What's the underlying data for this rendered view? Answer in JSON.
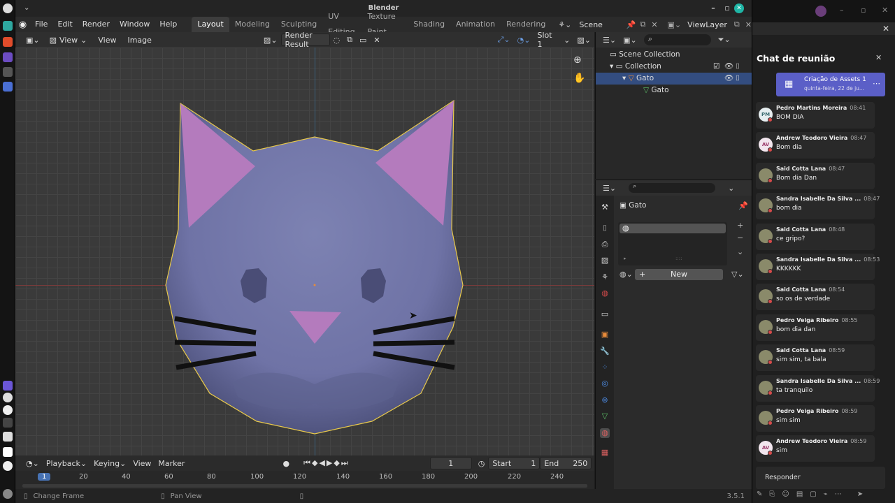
{
  "app": {
    "title": "Blender"
  },
  "menubar": {
    "menus": [
      "File",
      "Edit",
      "Render",
      "Window",
      "Help"
    ],
    "workspaces": [
      "Layout",
      "Modeling",
      "Sculpting",
      "UV Editing",
      "Texture Paint",
      "Shading",
      "Animation",
      "Rendering"
    ],
    "active_workspace": "Layout",
    "scene": "Scene",
    "view_layer": "ViewLayer"
  },
  "image_editor": {
    "view_menu": "View",
    "menus": [
      "View",
      "Image"
    ],
    "image_name": "Render Result",
    "slot": "Slot 1"
  },
  "outliner": {
    "scene_collection": "Scene Collection",
    "collection": "Collection",
    "object": "Gato",
    "mesh": "Gato"
  },
  "properties": {
    "object_name": "Gato",
    "new_button": "New"
  },
  "timeline": {
    "menus": [
      "Playback",
      "Keying",
      "View",
      "Marker"
    ],
    "current_frame": "1",
    "start_label": "Start",
    "start": "1",
    "end_label": "End",
    "end": "250",
    "ruler_marks": [
      "1",
      "20",
      "40",
      "60",
      "80",
      "100",
      "120",
      "140",
      "160",
      "180",
      "200",
      "220",
      "240"
    ]
  },
  "statusbar": {
    "left": "Change Frame",
    "middle": "Pan View",
    "version": "3.5.1"
  },
  "chat": {
    "title": "Chat de reunião",
    "meeting_title": "Criação de Assets 1",
    "meeting_date": "quinta-feira, 22 de ju...",
    "reply_label": "Responder",
    "messages": [
      {
        "author": "Pedro Martins Moreira",
        "time": "08:41",
        "text": "BOM DIA",
        "initials": "PM"
      },
      {
        "author": "Andrew Teodoro Vieira",
        "time": "08:47",
        "text": "Bom dia",
        "initials": "AV"
      },
      {
        "author": "Said Cotta Lana",
        "time": "08:47",
        "text": "Bom dia Dan",
        "initials": ""
      },
      {
        "author": "Sandra Isabelle Da Silva ...",
        "time": "08:47",
        "text": "bom dia",
        "initials": ""
      },
      {
        "author": "Said Cotta Lana",
        "time": "08:48",
        "text": "ce gripo?",
        "initials": ""
      },
      {
        "author": "Sandra Isabelle Da Silva ...",
        "time": "08:53",
        "text": "KKKKKK",
        "initials": ""
      },
      {
        "author": "Said Cotta Lana",
        "time": "08:54",
        "text": "so os de verdade",
        "initials": ""
      },
      {
        "author": "Pedro Veiga Ribeiro",
        "time": "08:55",
        "text": "bom dia dan",
        "initials": ""
      },
      {
        "author": "Said Cotta Lana",
        "time": "08:59",
        "text": "sim sim, ta bala",
        "initials": ""
      },
      {
        "author": "Sandra Isabelle Da Silva ...",
        "time": "08:59",
        "text": "ta tranquilo",
        "initials": ""
      },
      {
        "author": "Pedro Veiga Ribeiro",
        "time": "08:59",
        "text": "sim sim",
        "initials": ""
      },
      {
        "author": "Andrew Teodoro Vieira",
        "time": "08:59",
        "text": "sim",
        "initials": "AV"
      }
    ]
  },
  "colors": {
    "accent": "#4772b3",
    "meeting_card": "#5b5fc7",
    "cat_body": "#7479a8",
    "cat_ear": "#b47bbd",
    "selection": "#e8c94a"
  }
}
